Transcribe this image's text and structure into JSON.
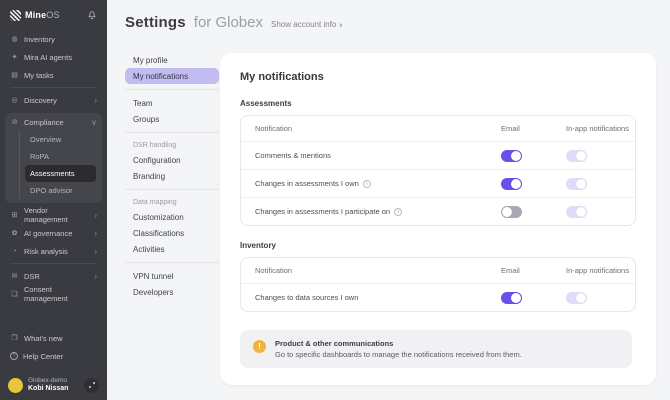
{
  "app": {
    "logo_bold": "Mine",
    "logo_light": "OS"
  },
  "sidebar": {
    "nav": [
      {
        "icon": "◍",
        "label": "Inventory"
      },
      {
        "icon": "✦",
        "label": "Mira AI agents"
      },
      {
        "icon": "▤",
        "label": "My tasks"
      },
      {
        "icon": "◎",
        "label": "Discovery",
        "chevron": "›"
      },
      {
        "icon": "⊘",
        "label": "Compliance",
        "chevron": "∨"
      }
    ],
    "compliance_children": [
      {
        "label": "Overview"
      },
      {
        "label": "RoPA"
      },
      {
        "label": "Assessments",
        "selected": true
      },
      {
        "label": "DPO advisor"
      }
    ],
    "nav2": [
      {
        "icon": "⊞",
        "label": "Vendor management",
        "chevron": "›"
      },
      {
        "icon": "✿",
        "label": "AI governance",
        "chevron": "›"
      },
      {
        "icon": "◔",
        "label": "Risk analysis",
        "chevron": "›"
      }
    ],
    "nav3": [
      {
        "icon": "✉",
        "label": "DSR",
        "chevron": "›"
      },
      {
        "icon": "❏",
        "label": "Consent management"
      }
    ],
    "footer": [
      {
        "icon": "❐",
        "label": "What's new"
      },
      {
        "icon": "?",
        "label": "Help Center"
      }
    ],
    "user": {
      "org": "Globex-demo",
      "name": "Kobi Nissan"
    }
  },
  "header": {
    "title_strong": "Settings",
    "title_light": "for Globex",
    "account_toggle": "Show account info",
    "chevron": "∨"
  },
  "settings_nav": {
    "selected": "My notifications",
    "group1": [
      {
        "label": "My profile"
      },
      {
        "label": "My notifications",
        "selected": true
      }
    ],
    "group2": [
      {
        "label": "Team"
      },
      {
        "label": "Groups"
      }
    ],
    "dsr_section_label": "DSR handling",
    "group3": [
      {
        "label": "Configuration"
      },
      {
        "label": "Branding"
      }
    ],
    "mapping_section_label": "Data mapping",
    "group4": [
      {
        "label": "Customization"
      },
      {
        "label": "Classifications"
      },
      {
        "label": "Activities"
      }
    ],
    "group5": [
      {
        "label": "VPN tunnel"
      },
      {
        "label": "Developers"
      }
    ]
  },
  "content": {
    "title": "My notifications",
    "sections": [
      {
        "label": "Assessments",
        "columns": [
          "Notification",
          "Email",
          "In-app notifications"
        ],
        "rows": [
          {
            "label": "Comments & mentions",
            "email": "on",
            "in_app": "on-disabled"
          },
          {
            "label": "Changes in assessments I own",
            "info_icon": "i",
            "email": "on",
            "in_app": "on-disabled"
          },
          {
            "label": "Changes in assessments I participate on",
            "info_icon": "i",
            "email": "off",
            "in_app": "on-disabled"
          }
        ]
      },
      {
        "label": "Inventory",
        "columns": [
          "Notification",
          "Email",
          "In-app notifications"
        ],
        "rows": [
          {
            "label": "Changes to data sources I own",
            "email": "on",
            "in_app": "on-disabled"
          }
        ]
      }
    ],
    "banner": {
      "icon": "!",
      "title": "Product & other communications",
      "description": "Go to specific dashboards to manage the notifications received from them."
    }
  },
  "colors": {
    "accent": "#6b4fe8",
    "accent_light": "#e0dbf9",
    "nav_pill": "#c3bcf0",
    "toggle_off": "#a9a9b2",
    "warning": "#f0b43c",
    "sidebar_bg": "#3a3a41",
    "page_bg": "#f4f5f7",
    "card_bg": "#ffffff"
  }
}
